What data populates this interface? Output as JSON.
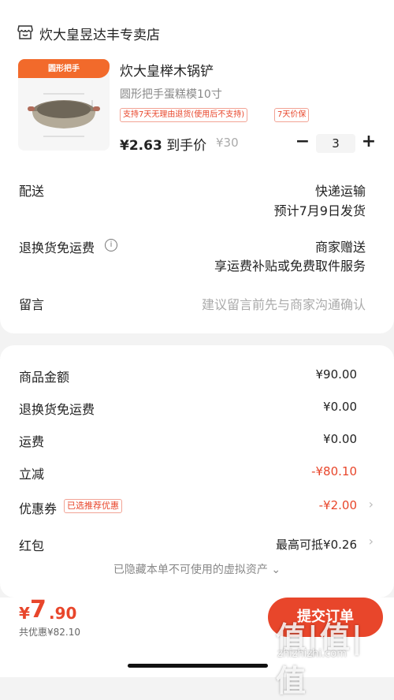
{
  "store": {
    "name": "炊大皇昱达丰专卖店",
    "icon": "store-icon"
  },
  "product": {
    "image_banner": "圆形把手",
    "title": "炊大皇榉木锅铲",
    "spec": "圆形把手蛋糕模10寸",
    "tags": [
      "支持7天无理由退货(使用后不支持)",
      "7天价保"
    ],
    "price": "¥2.63",
    "price_suffix": "到手价",
    "original_price": "¥30",
    "quantity": "3",
    "minus": "−",
    "plus": "+"
  },
  "delivery": {
    "label": "配送",
    "method": "快递运输",
    "eta": "预计7月9日发货"
  },
  "return_shipping": {
    "label": "退换货免运费",
    "info_icon": "i",
    "value": "商家赠送",
    "detail": "享运费补贴或免费取件服务"
  },
  "message": {
    "label": "留言",
    "placeholder": "建议留言前先与商家沟通确认"
  },
  "summary": {
    "goods_amount": {
      "label": "商品金额",
      "value": "¥90.00"
    },
    "return_fee": {
      "label": "退换货免运费",
      "value": "¥0.00"
    },
    "shipping": {
      "label": "运费",
      "value": "¥0.00"
    },
    "discount": {
      "label": "立减",
      "value": "-¥80.10"
    },
    "coupon": {
      "label": "优惠券",
      "badge": "已选推荐优惠",
      "value": "-¥2.00"
    },
    "red_packet": {
      "label": "红包",
      "value": "最高可抵¥0.26"
    },
    "hidden_note": "已隐藏本单不可使用的虚拟资产"
  },
  "footer": {
    "currency": "¥",
    "total_int": "7",
    "total_dec": ".90",
    "saved": "共优惠¥82.10",
    "submit": "提交订单"
  },
  "watermark": {
    "big": "值|值|值",
    "small": "zhizhizhi.com"
  },
  "colors": {
    "accent": "#e8462b",
    "banner": "#f26a2b"
  }
}
